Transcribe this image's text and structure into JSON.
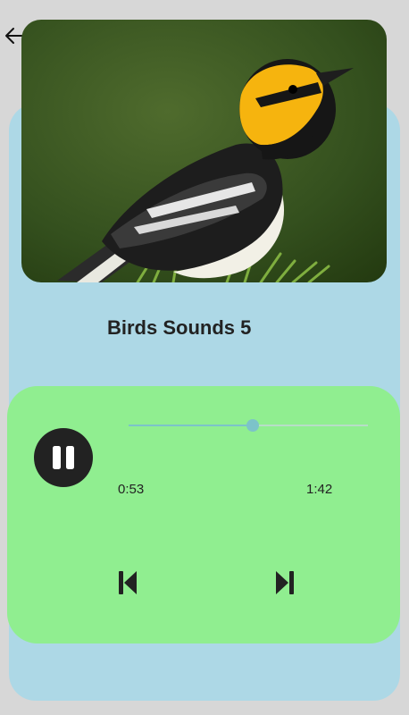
{
  "header": {
    "back_icon": "arrow-left-icon"
  },
  "track": {
    "title": "Birds Sounds 5",
    "image": "yellow-faced-warbler-photo"
  },
  "player": {
    "state_icon": "pause-icon",
    "current_time": "0:53",
    "total_time": "1:42",
    "progress": 0.52,
    "prev_icon": "skip-previous-icon",
    "next_icon": "skip-next-icon"
  },
  "colors": {
    "background": "#d7d7d7",
    "card": "#add8e6",
    "player_panel": "#90ee90",
    "control": "#222222",
    "seek_accent": "#7cc3c9"
  }
}
